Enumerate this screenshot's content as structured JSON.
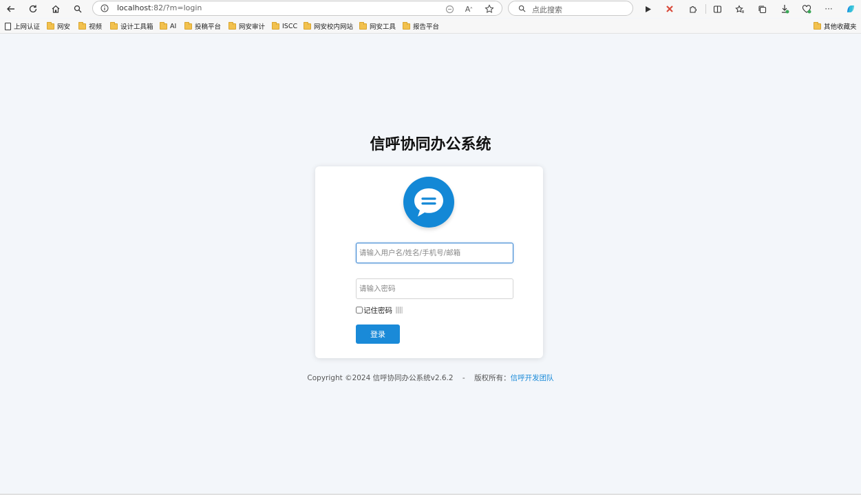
{
  "browser": {
    "url_host": "localhost",
    "url_rest": ":82/?m=login",
    "search_placeholder": "点此搜索",
    "icons": [
      "back-icon",
      "refresh-icon",
      "home-icon",
      "search-icon",
      "info-icon",
      "translate-icon",
      "read-aloud-icon",
      "favorite-star-icon",
      "play-icon",
      "extension-icon",
      "puzzle-icon",
      "split-screen-icon",
      "favorites-icon",
      "collections-icon",
      "downloads-icon",
      "performance-icon",
      "more-icon",
      "copilot-icon"
    ]
  },
  "bookmarks": [
    {
      "label": "上网认证",
      "type": "page"
    },
    {
      "label": "网安",
      "type": "folder"
    },
    {
      "label": "视频",
      "type": "folder"
    },
    {
      "label": "设计工具箱",
      "type": "folder"
    },
    {
      "label": "AI",
      "type": "folder"
    },
    {
      "label": "投稿平台",
      "type": "folder"
    },
    {
      "label": "网安审计",
      "type": "folder"
    },
    {
      "label": "ISCC",
      "type": "folder"
    },
    {
      "label": "网安校内网站",
      "type": "folder"
    },
    {
      "label": "网安工具",
      "type": "folder"
    },
    {
      "label": "报告平台",
      "type": "folder"
    }
  ],
  "other_bookmarks": "其他收藏夹",
  "page": {
    "title": "信呼协同办公系统",
    "username_placeholder": "请输入用户名/姓名/手机号/邮箱",
    "password_placeholder": "请输入密码",
    "remember_label": "记住密码",
    "login_label": "登录",
    "footer_copyright": "Copyright ©2024 信呼协同办公系统v2.6.2",
    "footer_sep": "-",
    "footer_rights": "版权所有：",
    "footer_link": "信呼开发团队"
  },
  "colors": {
    "accent": "#1a8ad8",
    "background": "#f3f6fa"
  }
}
